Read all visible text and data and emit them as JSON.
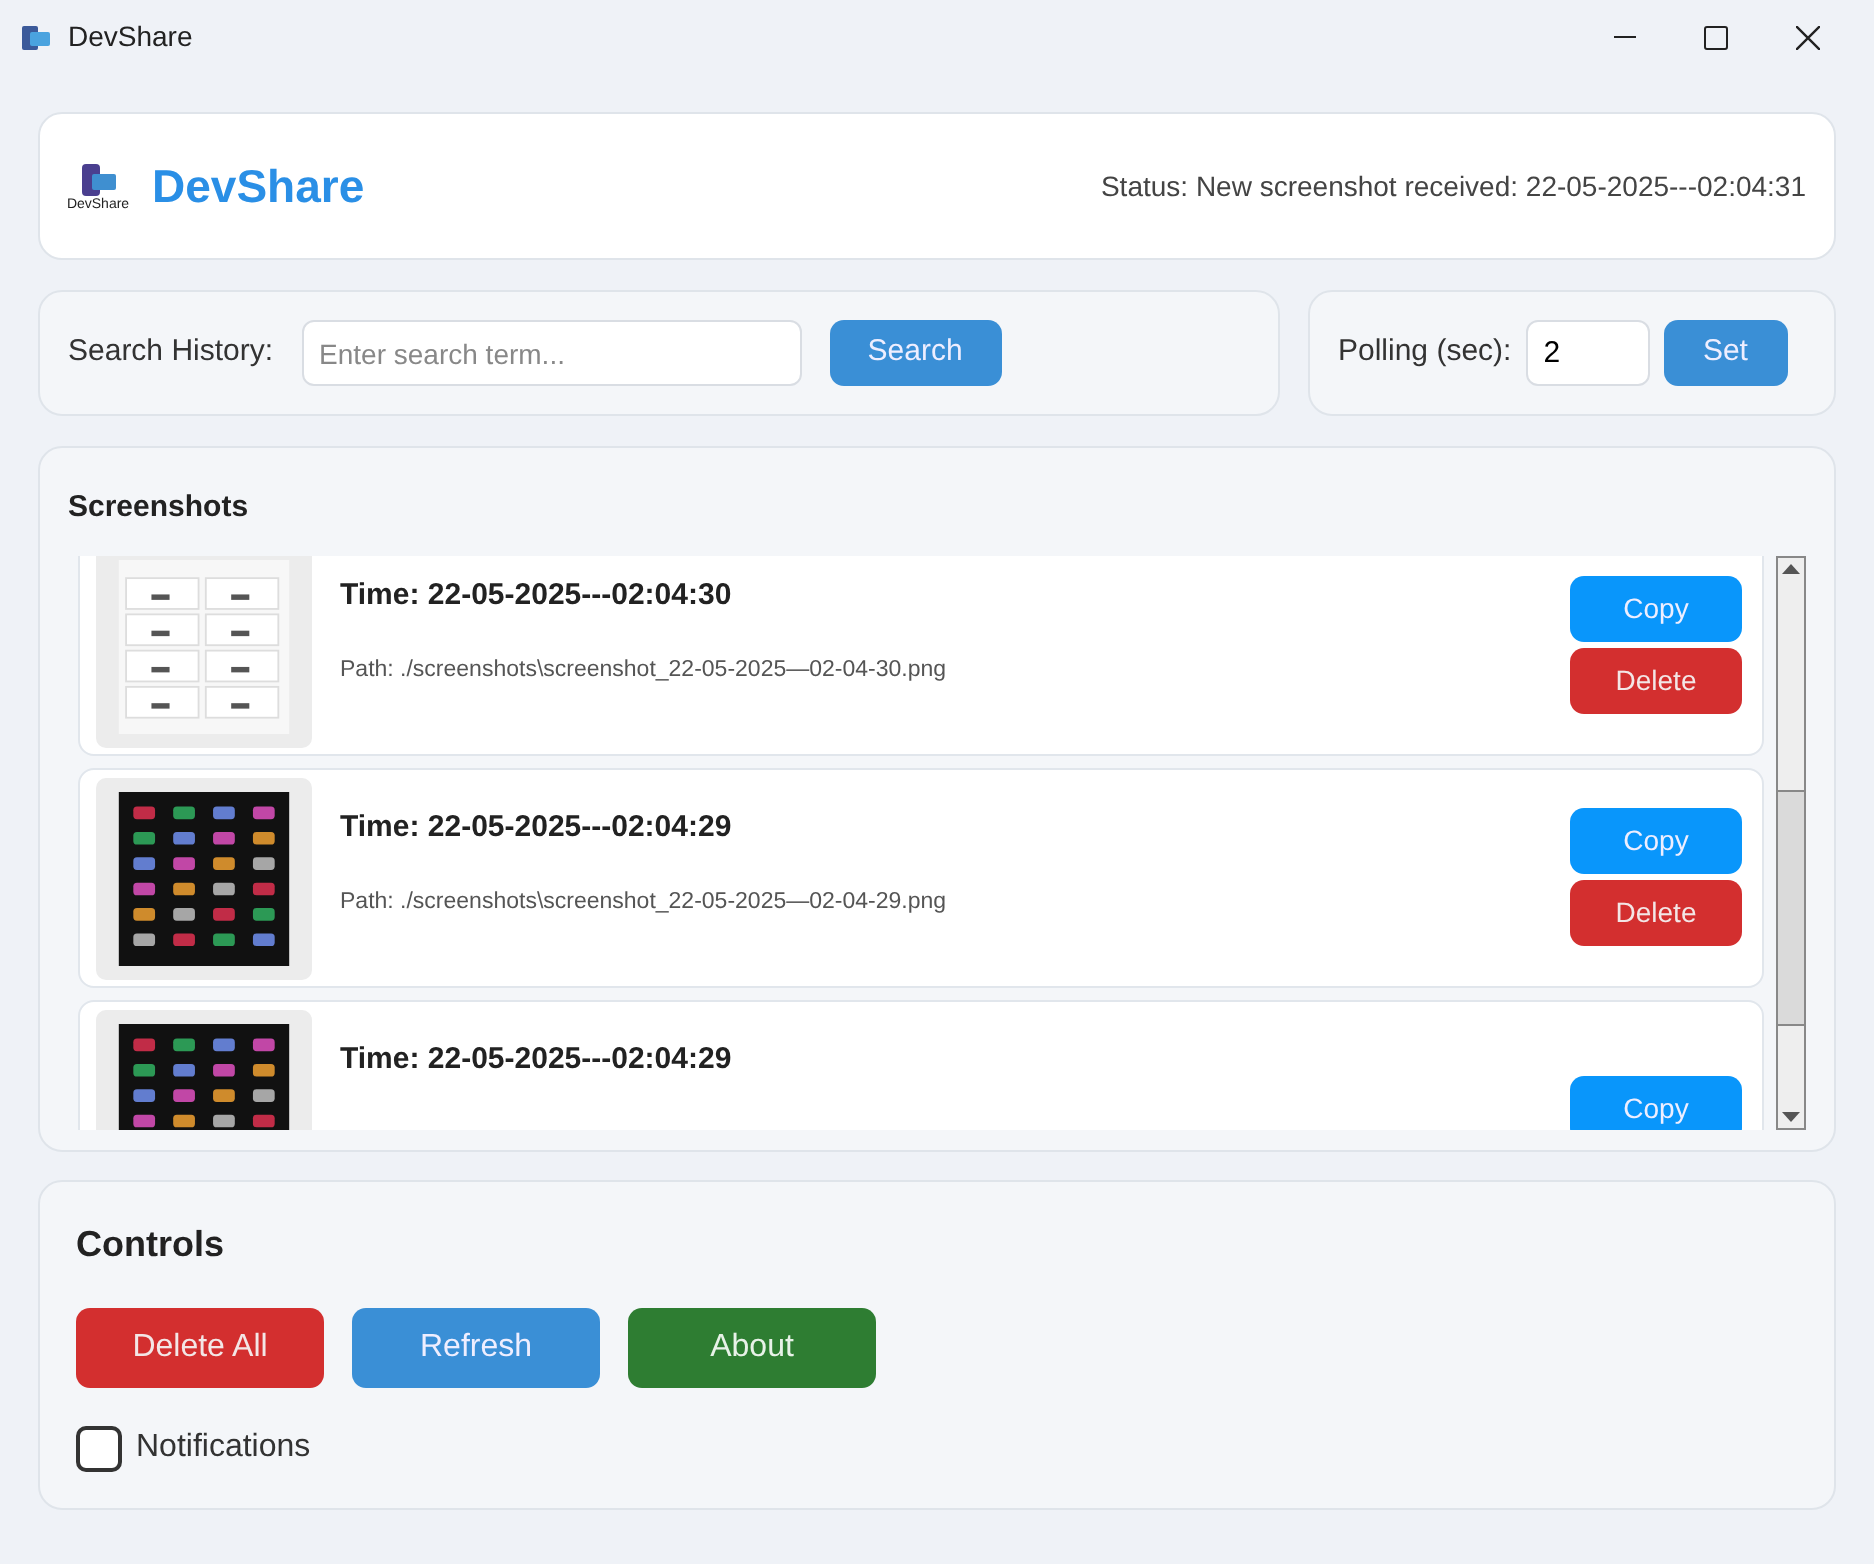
{
  "window": {
    "title": "DevShare"
  },
  "header": {
    "logo_caption": "DevShare",
    "title": "DevShare",
    "status": "Status: New screenshot received: 22-05-2025---02:04:31"
  },
  "search": {
    "label": "Search History:",
    "placeholder": "Enter search term...",
    "button": "Search"
  },
  "polling": {
    "label": "Polling (sec):",
    "value": "2",
    "button": "Set"
  },
  "screenshots": {
    "title": "Screenshots",
    "items": [
      {
        "kind": "light",
        "time": "Time: 22-05-2025---02:04:30",
        "path": "Path: ./screenshots\\screenshot_22-05-2025—02-04-30.png",
        "buttons": [
          "Copy",
          "Delete"
        ]
      },
      {
        "kind": "dark",
        "time": "Time: 22-05-2025---02:04:29",
        "path": "Path: ./screenshots\\screenshot_22-05-2025—02-04-29.png",
        "buttons": [
          "Copy",
          "Delete"
        ]
      },
      {
        "kind": "dark",
        "time": "Time: 22-05-2025---02:04:29",
        "buttons": [
          "Copy"
        ]
      }
    ]
  },
  "controls": {
    "title": "Controls",
    "buttons": [
      {
        "label": "Delete All",
        "kind": "danger"
      },
      {
        "label": "Refresh",
        "kind": "primary"
      },
      {
        "label": "About",
        "kind": "success"
      }
    ],
    "notifications": {
      "label": "Notifications",
      "checked": false
    }
  }
}
